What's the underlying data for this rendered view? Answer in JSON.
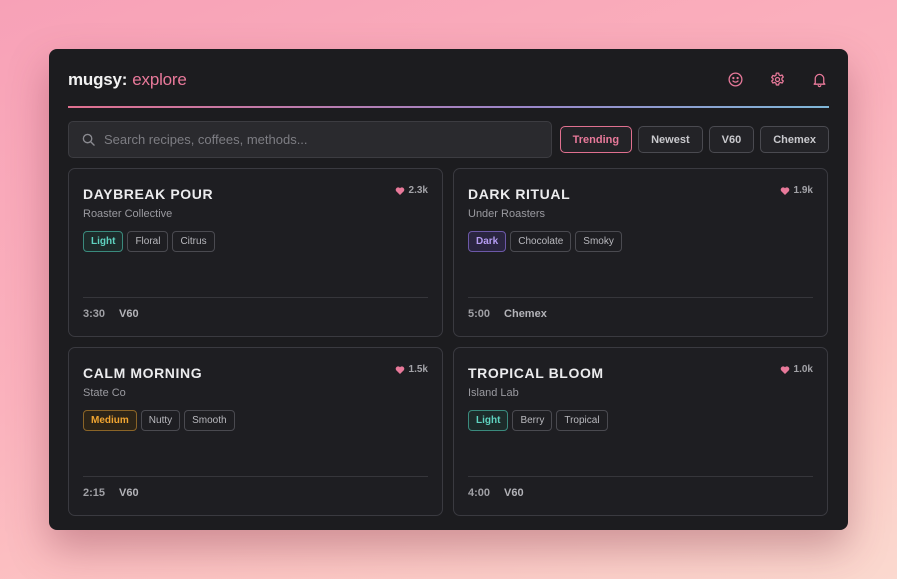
{
  "app": {
    "brand": "mugsy:",
    "section": "explore"
  },
  "header_icons": [
    "smiley-icon",
    "gear-icon",
    "bell-icon"
  ],
  "colors": {
    "accent": "#e8799a",
    "background": "#1c1c1f",
    "light_roast": "#5fd3c0",
    "dark_roast": "#b59cf2",
    "medium_roast": "#f0a531"
  },
  "search": {
    "placeholder": "Search recipes, coffees, methods...",
    "value": ""
  },
  "filters": [
    {
      "label": "Trending",
      "active": true
    },
    {
      "label": "Newest",
      "active": false
    },
    {
      "label": "V60",
      "active": false
    },
    {
      "label": "Chemex",
      "active": false
    }
  ],
  "cards": [
    {
      "title": "DAYBREAK POUR",
      "roaster": "Roaster Collective",
      "likes": "2.3k",
      "roast": "Light",
      "roast_class": "light",
      "notes": [
        "Floral",
        "Citrus"
      ],
      "time": "3:30",
      "method": "V60"
    },
    {
      "title": "DARK RITUAL",
      "roaster": "Under Roasters",
      "likes": "1.9k",
      "roast": "Dark",
      "roast_class": "dark",
      "notes": [
        "Chocolate",
        "Smoky"
      ],
      "time": "5:00",
      "method": "Chemex"
    },
    {
      "title": "CALM MORNING",
      "roaster": "State Co",
      "likes": "1.5k",
      "roast": "Medium",
      "roast_class": "medium",
      "notes": [
        "Nutty",
        "Smooth"
      ],
      "time": "2:15",
      "method": "V60"
    },
    {
      "title": "TROPICAL BLOOM",
      "roaster": "Island Lab",
      "likes": "1.0k",
      "roast": "Light",
      "roast_class": "light",
      "notes": [
        "Berry",
        "Tropical"
      ],
      "time": "4:00",
      "method": "V60"
    }
  ]
}
